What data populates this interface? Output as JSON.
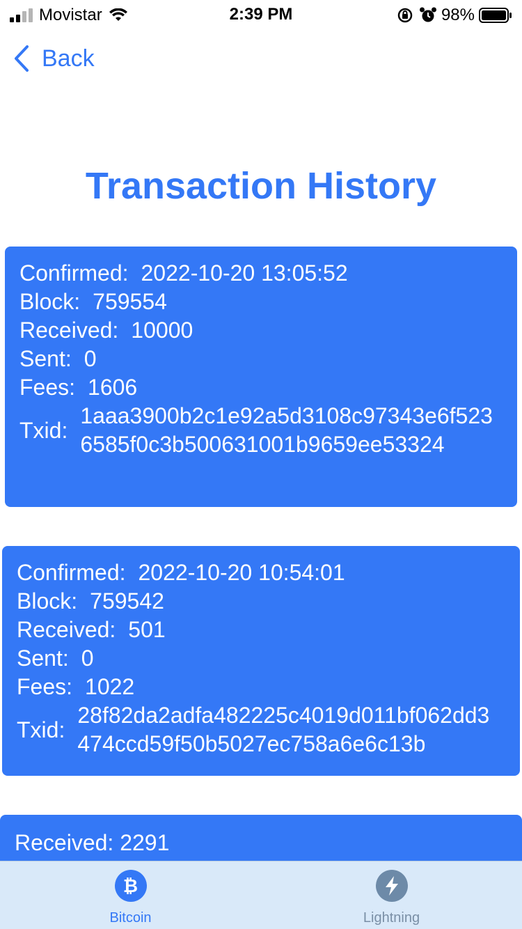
{
  "status_bar": {
    "carrier": "Movistar",
    "time": "2:39 PM",
    "battery": "98%",
    "signal_icon": "signal-bars-icon",
    "wifi_icon": "wifi-icon",
    "orientation_lock_icon": "orientation-lock-icon",
    "alarm_icon": "alarm-icon",
    "battery_icon": "battery-icon"
  },
  "nav": {
    "back_label": "Back",
    "back_icon": "chevron-left-icon"
  },
  "page": {
    "title": "Transaction History"
  },
  "labels": {
    "confirmed": "Confirmed:",
    "block": "Block:",
    "received": "Received:",
    "sent": "Sent:",
    "fees": "Fees:",
    "txid": "Txid:"
  },
  "transactions": [
    {
      "confirmed": "2022-10-20 13:05:52",
      "block": "759554",
      "received": "10000",
      "sent": "0",
      "fees": "1606",
      "txid": "1aaa3900b2c1e92a5d3108c97343e6f5236585f0c3b500631001b9659ee53324"
    },
    {
      "confirmed": "2022-10-20 10:54:01",
      "block": "759542",
      "received": "501",
      "sent": "0",
      "fees": "1022",
      "txid": "28f82da2adfa482225c4019d011bf062dd3474ccd59f50b5027ec758a6e6c13b"
    },
    {
      "received_text": "Received: 2291"
    }
  ],
  "tabs": [
    {
      "label": "Bitcoin",
      "icon": "bitcoin-icon",
      "glyph": "₿",
      "active": true
    },
    {
      "label": "Lightning",
      "icon": "lightning-icon",
      "active": false
    }
  ],
  "colors": {
    "accent": "#3478f6",
    "tab_bar_bg": "#d9e9f9",
    "inactive": "#6d8aa8"
  }
}
